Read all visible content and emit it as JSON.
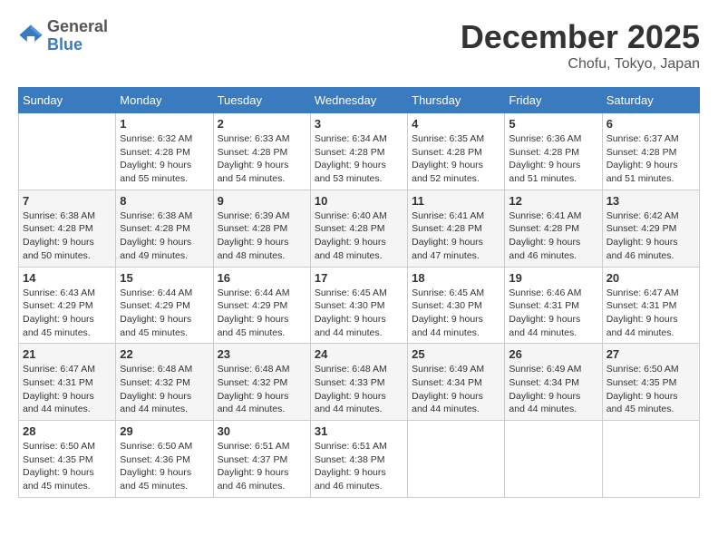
{
  "header": {
    "logo": {
      "general": "General",
      "blue": "Blue"
    },
    "title": "December 2025",
    "location": "Chofu, Tokyo, Japan"
  },
  "weekdays": [
    "Sunday",
    "Monday",
    "Tuesday",
    "Wednesday",
    "Thursday",
    "Friday",
    "Saturday"
  ],
  "weeks": [
    [
      {
        "day": "",
        "sunrise": "",
        "sunset": "",
        "daylight": ""
      },
      {
        "day": "1",
        "sunrise": "Sunrise: 6:32 AM",
        "sunset": "Sunset: 4:28 PM",
        "daylight": "Daylight: 9 hours and 55 minutes."
      },
      {
        "day": "2",
        "sunrise": "Sunrise: 6:33 AM",
        "sunset": "Sunset: 4:28 PM",
        "daylight": "Daylight: 9 hours and 54 minutes."
      },
      {
        "day": "3",
        "sunrise": "Sunrise: 6:34 AM",
        "sunset": "Sunset: 4:28 PM",
        "daylight": "Daylight: 9 hours and 53 minutes."
      },
      {
        "day": "4",
        "sunrise": "Sunrise: 6:35 AM",
        "sunset": "Sunset: 4:28 PM",
        "daylight": "Daylight: 9 hours and 52 minutes."
      },
      {
        "day": "5",
        "sunrise": "Sunrise: 6:36 AM",
        "sunset": "Sunset: 4:28 PM",
        "daylight": "Daylight: 9 hours and 51 minutes."
      },
      {
        "day": "6",
        "sunrise": "Sunrise: 6:37 AM",
        "sunset": "Sunset: 4:28 PM",
        "daylight": "Daylight: 9 hours and 51 minutes."
      }
    ],
    [
      {
        "day": "7",
        "sunrise": "Sunrise: 6:38 AM",
        "sunset": "Sunset: 4:28 PM",
        "daylight": "Daylight: 9 hours and 50 minutes."
      },
      {
        "day": "8",
        "sunrise": "Sunrise: 6:38 AM",
        "sunset": "Sunset: 4:28 PM",
        "daylight": "Daylight: 9 hours and 49 minutes."
      },
      {
        "day": "9",
        "sunrise": "Sunrise: 6:39 AM",
        "sunset": "Sunset: 4:28 PM",
        "daylight": "Daylight: 9 hours and 48 minutes."
      },
      {
        "day": "10",
        "sunrise": "Sunrise: 6:40 AM",
        "sunset": "Sunset: 4:28 PM",
        "daylight": "Daylight: 9 hours and 48 minutes."
      },
      {
        "day": "11",
        "sunrise": "Sunrise: 6:41 AM",
        "sunset": "Sunset: 4:28 PM",
        "daylight": "Daylight: 9 hours and 47 minutes."
      },
      {
        "day": "12",
        "sunrise": "Sunrise: 6:41 AM",
        "sunset": "Sunset: 4:28 PM",
        "daylight": "Daylight: 9 hours and 46 minutes."
      },
      {
        "day": "13",
        "sunrise": "Sunrise: 6:42 AM",
        "sunset": "Sunset: 4:29 PM",
        "daylight": "Daylight: 9 hours and 46 minutes."
      }
    ],
    [
      {
        "day": "14",
        "sunrise": "Sunrise: 6:43 AM",
        "sunset": "Sunset: 4:29 PM",
        "daylight": "Daylight: 9 hours and 45 minutes."
      },
      {
        "day": "15",
        "sunrise": "Sunrise: 6:44 AM",
        "sunset": "Sunset: 4:29 PM",
        "daylight": "Daylight: 9 hours and 45 minutes."
      },
      {
        "day": "16",
        "sunrise": "Sunrise: 6:44 AM",
        "sunset": "Sunset: 4:29 PM",
        "daylight": "Daylight: 9 hours and 45 minutes."
      },
      {
        "day": "17",
        "sunrise": "Sunrise: 6:45 AM",
        "sunset": "Sunset: 4:30 PM",
        "daylight": "Daylight: 9 hours and 44 minutes."
      },
      {
        "day": "18",
        "sunrise": "Sunrise: 6:45 AM",
        "sunset": "Sunset: 4:30 PM",
        "daylight": "Daylight: 9 hours and 44 minutes."
      },
      {
        "day": "19",
        "sunrise": "Sunrise: 6:46 AM",
        "sunset": "Sunset: 4:31 PM",
        "daylight": "Daylight: 9 hours and 44 minutes."
      },
      {
        "day": "20",
        "sunrise": "Sunrise: 6:47 AM",
        "sunset": "Sunset: 4:31 PM",
        "daylight": "Daylight: 9 hours and 44 minutes."
      }
    ],
    [
      {
        "day": "21",
        "sunrise": "Sunrise: 6:47 AM",
        "sunset": "Sunset: 4:31 PM",
        "daylight": "Daylight: 9 hours and 44 minutes."
      },
      {
        "day": "22",
        "sunrise": "Sunrise: 6:48 AM",
        "sunset": "Sunset: 4:32 PM",
        "daylight": "Daylight: 9 hours and 44 minutes."
      },
      {
        "day": "23",
        "sunrise": "Sunrise: 6:48 AM",
        "sunset": "Sunset: 4:32 PM",
        "daylight": "Daylight: 9 hours and 44 minutes."
      },
      {
        "day": "24",
        "sunrise": "Sunrise: 6:48 AM",
        "sunset": "Sunset: 4:33 PM",
        "daylight": "Daylight: 9 hours and 44 minutes."
      },
      {
        "day": "25",
        "sunrise": "Sunrise: 6:49 AM",
        "sunset": "Sunset: 4:34 PM",
        "daylight": "Daylight: 9 hours and 44 minutes."
      },
      {
        "day": "26",
        "sunrise": "Sunrise: 6:49 AM",
        "sunset": "Sunset: 4:34 PM",
        "daylight": "Daylight: 9 hours and 44 minutes."
      },
      {
        "day": "27",
        "sunrise": "Sunrise: 6:50 AM",
        "sunset": "Sunset: 4:35 PM",
        "daylight": "Daylight: 9 hours and 45 minutes."
      }
    ],
    [
      {
        "day": "28",
        "sunrise": "Sunrise: 6:50 AM",
        "sunset": "Sunset: 4:35 PM",
        "daylight": "Daylight: 9 hours and 45 minutes."
      },
      {
        "day": "29",
        "sunrise": "Sunrise: 6:50 AM",
        "sunset": "Sunset: 4:36 PM",
        "daylight": "Daylight: 9 hours and 45 minutes."
      },
      {
        "day": "30",
        "sunrise": "Sunrise: 6:51 AM",
        "sunset": "Sunset: 4:37 PM",
        "daylight": "Daylight: 9 hours and 46 minutes."
      },
      {
        "day": "31",
        "sunrise": "Sunrise: 6:51 AM",
        "sunset": "Sunset: 4:38 PM",
        "daylight": "Daylight: 9 hours and 46 minutes."
      },
      {
        "day": "",
        "sunrise": "",
        "sunset": "",
        "daylight": ""
      },
      {
        "day": "",
        "sunrise": "",
        "sunset": "",
        "daylight": ""
      },
      {
        "day": "",
        "sunrise": "",
        "sunset": "",
        "daylight": ""
      }
    ]
  ]
}
